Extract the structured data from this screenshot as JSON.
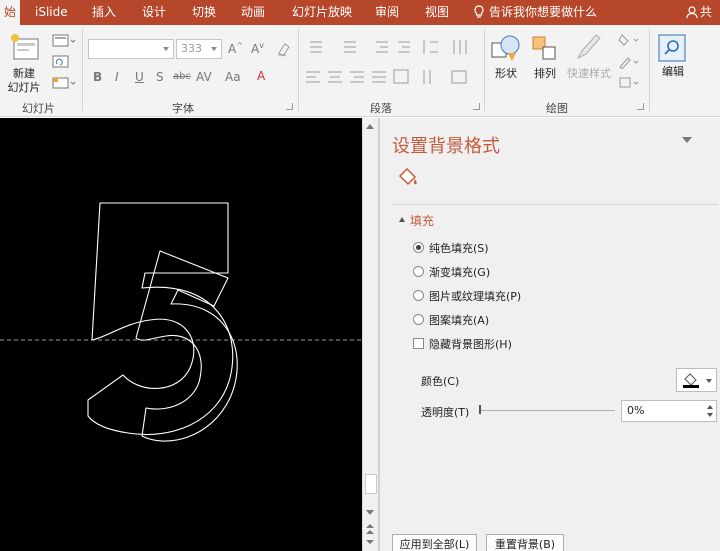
{
  "tabs": [
    {
      "label": "始",
      "active": true
    },
    {
      "label": "iSlide"
    },
    {
      "label": "插入"
    },
    {
      "label": "设计"
    },
    {
      "label": "切换"
    },
    {
      "label": "动画"
    },
    {
      "label": "幻灯片放映"
    },
    {
      "label": "审阅"
    },
    {
      "label": "视图"
    }
  ],
  "tell_me": "告诉我你想要做什么",
  "user_label": "共享",
  "ribbon": {
    "slides": {
      "new_slide_line1": "新建",
      "new_slide_line2": "幻灯片",
      "group": "幻灯片"
    },
    "font": {
      "size_value": "333",
      "group": "字体"
    },
    "paragraph": {
      "group": "段落"
    },
    "drawing": {
      "shape": "形状",
      "arrange": "排列",
      "quick_style": "快速样式",
      "group": "绘图"
    },
    "editing": {
      "label": "编辑"
    }
  },
  "slide": {
    "content": "5",
    "background": "#000000",
    "outline_color": "#ffffff"
  },
  "pane": {
    "title": "设置背景格式",
    "section": "填充",
    "options": [
      {
        "label": "纯色填充(S)",
        "selected": true
      },
      {
        "label": "渐变填充(G)",
        "selected": false
      },
      {
        "label": "图片或纹理填充(P)",
        "selected": false
      },
      {
        "label": "图案填充(A)",
        "selected": false
      }
    ],
    "hide_bg_graphics": "隐藏背景图形(H)",
    "color_label": "颜色(C)",
    "transparency_label": "透明度(T)",
    "transparency_value": "0%",
    "transparency": 0,
    "apply_all": "应用到全部(L)",
    "reset_bg": "重置背景(B)"
  },
  "colors": {
    "accent": "#b7472a",
    "pane_title": "#c55a3c"
  }
}
